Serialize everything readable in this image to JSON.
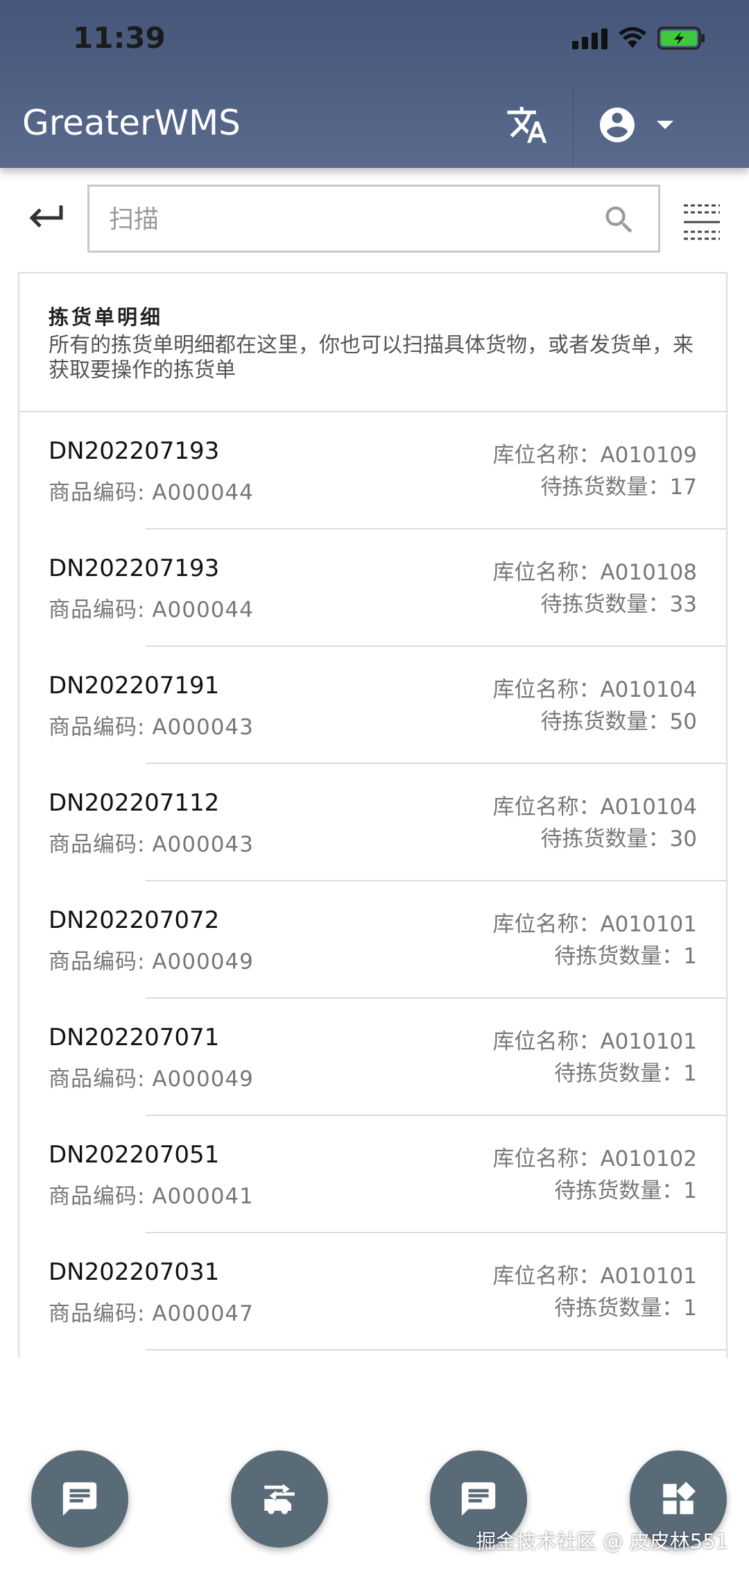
{
  "status_bar": {
    "time": "11:39"
  },
  "header": {
    "title": "GreaterWMS"
  },
  "search": {
    "placeholder": "扫描",
    "value": ""
  },
  "card": {
    "title": "拣货单明细",
    "description": "所有的拣货单明细都在这里，你也可以扫描具体货物，或者发货单，来获取要操作的拣货单"
  },
  "labels": {
    "item_code": "商品编码:",
    "bin_name": "库位名称：",
    "pick_qty": "待拣货数量："
  },
  "rows": [
    {
      "dn": "DN202207193",
      "item_code": "A000044",
      "bin": "A010109",
      "qty": "17"
    },
    {
      "dn": "DN202207193",
      "item_code": "A000044",
      "bin": "A010108",
      "qty": "33"
    },
    {
      "dn": "DN202207191",
      "item_code": "A000043",
      "bin": "A010104",
      "qty": "50"
    },
    {
      "dn": "DN202207112",
      "item_code": "A000043",
      "bin": "A010104",
      "qty": "30"
    },
    {
      "dn": "DN202207072",
      "item_code": "A000049",
      "bin": "A010101",
      "qty": "1"
    },
    {
      "dn": "DN202207071",
      "item_code": "A000049",
      "bin": "A010101",
      "qty": "1"
    },
    {
      "dn": "DN202207051",
      "item_code": "A000041",
      "bin": "A010102",
      "qty": "1"
    },
    {
      "dn": "DN202207031",
      "item_code": "A000047",
      "bin": "A010101",
      "qty": "1"
    }
  ],
  "fabs": [
    {
      "icon": "message-icon"
    },
    {
      "icon": "shipping-icon"
    },
    {
      "icon": "message-icon"
    },
    {
      "icon": "widgets-icon"
    }
  ],
  "watermark": "掘金技术社区 @ 皮皮林551",
  "colors": {
    "header": "#4d5d80",
    "fab": "#5a6b78"
  }
}
